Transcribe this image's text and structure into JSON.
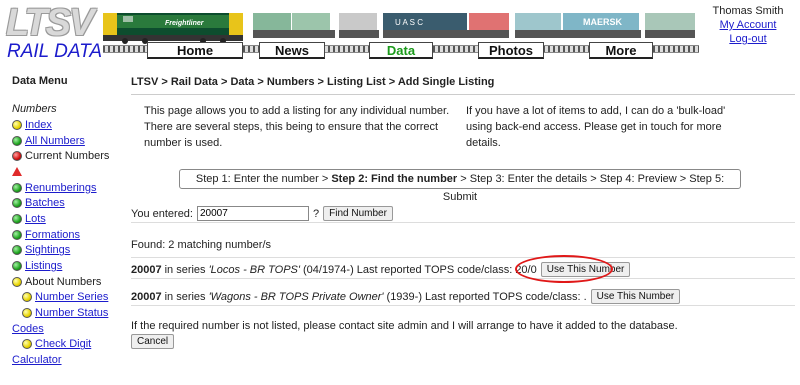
{
  "header": {
    "logo_top": "LTSV",
    "logo_bottom": "RAIL DATA",
    "train_labels": [
      "Freightliner",
      "U A S C",
      "MAERSK"
    ],
    "nav": [
      {
        "label": "Home",
        "active": false
      },
      {
        "label": "News",
        "active": false
      },
      {
        "label": "Data",
        "active": true
      },
      {
        "label": "Photos",
        "active": false
      },
      {
        "label": "More",
        "active": false
      }
    ],
    "user_name": "Thomas Smith",
    "my_account": "My Account",
    "logout": "Log-out"
  },
  "sidebar": {
    "title": "Data Menu",
    "section": "Numbers",
    "items": [
      {
        "label": "Index",
        "icon": "yellow",
        "link": true
      },
      {
        "label": "All Numbers",
        "icon": "green",
        "link": true
      },
      {
        "label": "Current Numbers",
        "icon": "red",
        "link": false
      },
      {
        "label": "",
        "icon": "warning",
        "link": false
      },
      {
        "label": "Renumberings",
        "icon": "green",
        "link": true
      },
      {
        "label": "Batches",
        "icon": "green",
        "link": true
      },
      {
        "label": "Lots",
        "icon": "green",
        "link": true
      },
      {
        "label": "Formations",
        "icon": "green",
        "link": true
      },
      {
        "label": "Sightings",
        "icon": "green",
        "link": true
      },
      {
        "label": "Listings",
        "icon": "green",
        "link": true
      },
      {
        "label": "About Numbers",
        "icon": "yellow",
        "link": false
      },
      {
        "label": "Number Series",
        "icon": "yellow",
        "link": true,
        "indent": true
      },
      {
        "label": "Number Status",
        "icon": "yellow",
        "link": true,
        "indent": true
      },
      {
        "label": "Codes",
        "icon": "",
        "link": true
      },
      {
        "label": "Check Digit",
        "icon": "yellow",
        "link": true,
        "indent": true
      },
      {
        "label": "Calculator",
        "icon": "",
        "link": true
      }
    ]
  },
  "main": {
    "breadcrumb": "LTSV > Rail Data > Data > Numbers > Listing List > Add Single Listing",
    "intro_left": "This page allows you to add a listing for any individual number. There are several steps, this being to ensure that the correct number is used.",
    "intro_right": "If you have a lot of items to add, I can do a 'bulk-load' using back-end access. Please get in touch for more details.",
    "steps": {
      "step1": "Step 1: Enter the number > ",
      "step2": "Step 2: Find the number",
      "rest": " > Step 3: Enter the details > Step 4: Preview > Step 5: Submit"
    },
    "entered_label": "You entered:",
    "entered_value": "20007",
    "qmark": "?",
    "find_button": "Find Number",
    "found_text": "Found: 2 matching number/s",
    "results": [
      {
        "number": "20007",
        "in_series": "in series",
        "series": "'Locos - BR TOPS'",
        "dates": "(04/1974-)",
        "code_text": "Last reported TOPS code/class: 20/0",
        "button": "Use This Number"
      },
      {
        "number": "20007",
        "in_series": "in series",
        "series": "'Wagons - BR TOPS Private Owner'",
        "dates": "(1939-)",
        "code_text": "Last reported TOPS code/class: .",
        "button": "Use This Number"
      }
    ],
    "footer_note": "If the required number is not listed, please contact site admin and I will arrange to have it added to the database.",
    "cancel_button": "Cancel"
  },
  "colors": {
    "link": "#1c1ccc",
    "active_nav": "#1b9a1b",
    "highlight_circle": "#e01818"
  }
}
